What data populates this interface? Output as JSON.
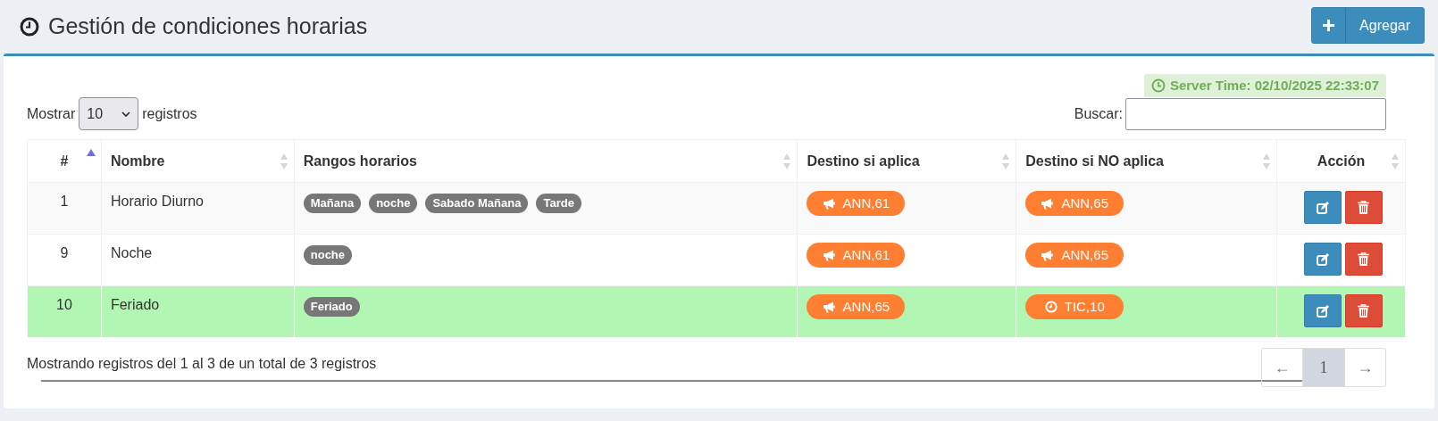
{
  "header": {
    "title": "Gestión de condiciones horarias",
    "add_button": "Agregar"
  },
  "server_time": "Server Time: 02/10/2025 22:33:07",
  "length_menu": {
    "prefix": "Mostrar",
    "value": "10",
    "suffix": "registros"
  },
  "search": {
    "label": "Buscar:"
  },
  "table": {
    "columns": [
      {
        "label": "#",
        "sorted": true
      },
      {
        "label": "Nombre",
        "sorted": false
      },
      {
        "label": "Rangos horarios",
        "sorted": false
      },
      {
        "label": "Destino si aplica",
        "sorted": false
      },
      {
        "label": "Destino si NO aplica",
        "sorted": false
      },
      {
        "label": "Acción",
        "sorted": false
      }
    ],
    "rows": [
      {
        "id": "1",
        "name": "Horario Diurno",
        "ranges": [
          "Mañana",
          "noche",
          "Sabado Mañana",
          "Tarde"
        ],
        "dest_yes": {
          "kind": "announcement",
          "label": "ANN,61"
        },
        "dest_no": {
          "kind": "announcement",
          "label": "ANN,65"
        },
        "highlighted": false
      },
      {
        "id": "9",
        "name": "Noche",
        "ranges": [
          "noche"
        ],
        "dest_yes": {
          "kind": "announcement",
          "label": "ANN,61"
        },
        "dest_no": {
          "kind": "announcement",
          "label": "ANN,65"
        },
        "highlighted": false
      },
      {
        "id": "10",
        "name": "Feriado",
        "ranges": [
          "Feriado"
        ],
        "dest_yes": {
          "kind": "announcement",
          "label": "ANN,65"
        },
        "dest_no": {
          "kind": "time_condition",
          "label": "TIC,10"
        },
        "highlighted": true
      }
    ]
  },
  "info": "Mostrando registros del 1 al 3 de un total de 3 registros",
  "pagination": {
    "previous": "←",
    "pages": [
      {
        "label": "1",
        "selected": true
      }
    ],
    "next": "→"
  }
}
